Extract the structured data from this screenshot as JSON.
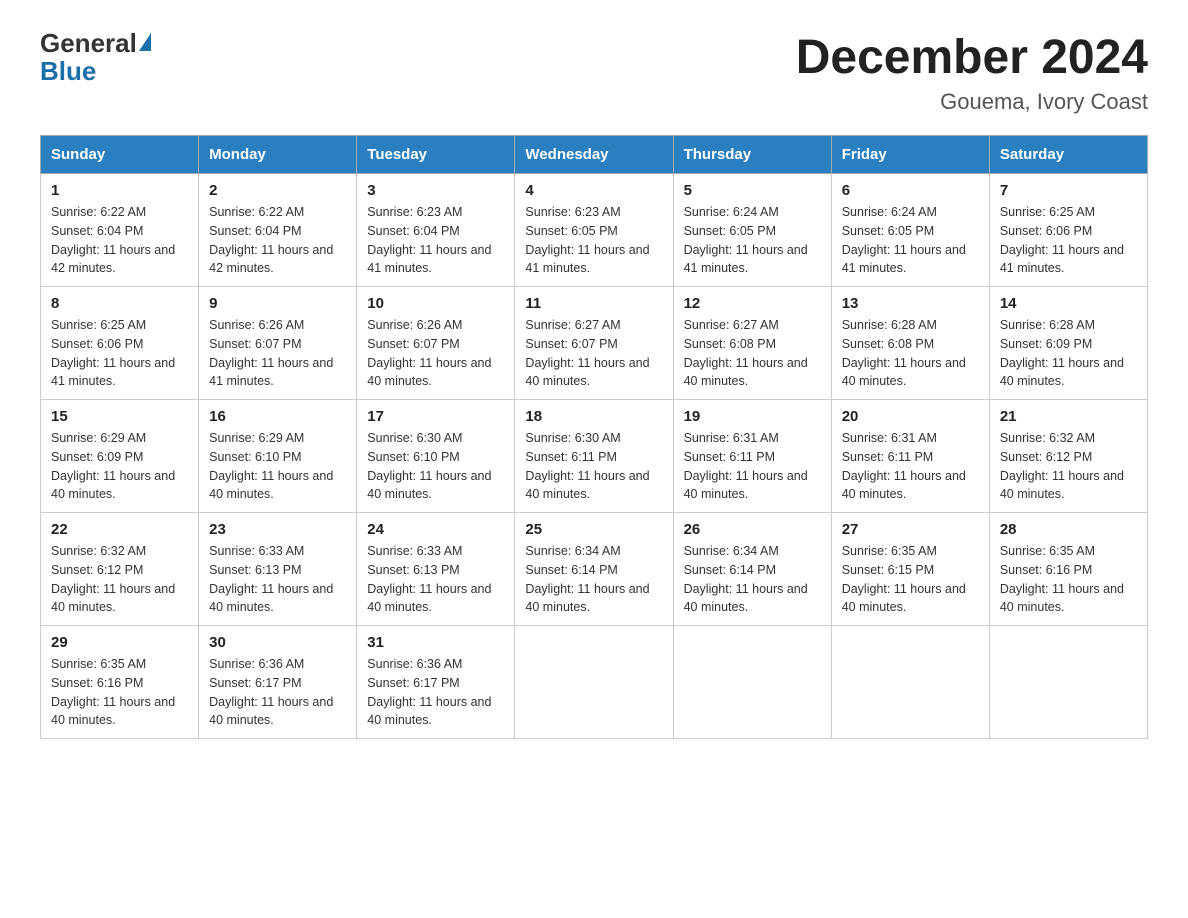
{
  "logo": {
    "general": "General",
    "blue": "Blue"
  },
  "title": "December 2024",
  "subtitle": "Gouema, Ivory Coast",
  "days": [
    "Sunday",
    "Monday",
    "Tuesday",
    "Wednesday",
    "Thursday",
    "Friday",
    "Saturday"
  ],
  "weeks": [
    [
      {
        "day": "1",
        "sunrise": "6:22 AM",
        "sunset": "6:04 PM",
        "daylight": "11 hours and 42 minutes."
      },
      {
        "day": "2",
        "sunrise": "6:22 AM",
        "sunset": "6:04 PM",
        "daylight": "11 hours and 42 minutes."
      },
      {
        "day": "3",
        "sunrise": "6:23 AM",
        "sunset": "6:04 PM",
        "daylight": "11 hours and 41 minutes."
      },
      {
        "day": "4",
        "sunrise": "6:23 AM",
        "sunset": "6:05 PM",
        "daylight": "11 hours and 41 minutes."
      },
      {
        "day": "5",
        "sunrise": "6:24 AM",
        "sunset": "6:05 PM",
        "daylight": "11 hours and 41 minutes."
      },
      {
        "day": "6",
        "sunrise": "6:24 AM",
        "sunset": "6:05 PM",
        "daylight": "11 hours and 41 minutes."
      },
      {
        "day": "7",
        "sunrise": "6:25 AM",
        "sunset": "6:06 PM",
        "daylight": "11 hours and 41 minutes."
      }
    ],
    [
      {
        "day": "8",
        "sunrise": "6:25 AM",
        "sunset": "6:06 PM",
        "daylight": "11 hours and 41 minutes."
      },
      {
        "day": "9",
        "sunrise": "6:26 AM",
        "sunset": "6:07 PM",
        "daylight": "11 hours and 41 minutes."
      },
      {
        "day": "10",
        "sunrise": "6:26 AM",
        "sunset": "6:07 PM",
        "daylight": "11 hours and 40 minutes."
      },
      {
        "day": "11",
        "sunrise": "6:27 AM",
        "sunset": "6:07 PM",
        "daylight": "11 hours and 40 minutes."
      },
      {
        "day": "12",
        "sunrise": "6:27 AM",
        "sunset": "6:08 PM",
        "daylight": "11 hours and 40 minutes."
      },
      {
        "day": "13",
        "sunrise": "6:28 AM",
        "sunset": "6:08 PM",
        "daylight": "11 hours and 40 minutes."
      },
      {
        "day": "14",
        "sunrise": "6:28 AM",
        "sunset": "6:09 PM",
        "daylight": "11 hours and 40 minutes."
      }
    ],
    [
      {
        "day": "15",
        "sunrise": "6:29 AM",
        "sunset": "6:09 PM",
        "daylight": "11 hours and 40 minutes."
      },
      {
        "day": "16",
        "sunrise": "6:29 AM",
        "sunset": "6:10 PM",
        "daylight": "11 hours and 40 minutes."
      },
      {
        "day": "17",
        "sunrise": "6:30 AM",
        "sunset": "6:10 PM",
        "daylight": "11 hours and 40 minutes."
      },
      {
        "day": "18",
        "sunrise": "6:30 AM",
        "sunset": "6:11 PM",
        "daylight": "11 hours and 40 minutes."
      },
      {
        "day": "19",
        "sunrise": "6:31 AM",
        "sunset": "6:11 PM",
        "daylight": "11 hours and 40 minutes."
      },
      {
        "day": "20",
        "sunrise": "6:31 AM",
        "sunset": "6:11 PM",
        "daylight": "11 hours and 40 minutes."
      },
      {
        "day": "21",
        "sunrise": "6:32 AM",
        "sunset": "6:12 PM",
        "daylight": "11 hours and 40 minutes."
      }
    ],
    [
      {
        "day": "22",
        "sunrise": "6:32 AM",
        "sunset": "6:12 PM",
        "daylight": "11 hours and 40 minutes."
      },
      {
        "day": "23",
        "sunrise": "6:33 AM",
        "sunset": "6:13 PM",
        "daylight": "11 hours and 40 minutes."
      },
      {
        "day": "24",
        "sunrise": "6:33 AM",
        "sunset": "6:13 PM",
        "daylight": "11 hours and 40 minutes."
      },
      {
        "day": "25",
        "sunrise": "6:34 AM",
        "sunset": "6:14 PM",
        "daylight": "11 hours and 40 minutes."
      },
      {
        "day": "26",
        "sunrise": "6:34 AM",
        "sunset": "6:14 PM",
        "daylight": "11 hours and 40 minutes."
      },
      {
        "day": "27",
        "sunrise": "6:35 AM",
        "sunset": "6:15 PM",
        "daylight": "11 hours and 40 minutes."
      },
      {
        "day": "28",
        "sunrise": "6:35 AM",
        "sunset": "6:16 PM",
        "daylight": "11 hours and 40 minutes."
      }
    ],
    [
      {
        "day": "29",
        "sunrise": "6:35 AM",
        "sunset": "6:16 PM",
        "daylight": "11 hours and 40 minutes."
      },
      {
        "day": "30",
        "sunrise": "6:36 AM",
        "sunset": "6:17 PM",
        "daylight": "11 hours and 40 minutes."
      },
      {
        "day": "31",
        "sunrise": "6:36 AM",
        "sunset": "6:17 PM",
        "daylight": "11 hours and 40 minutes."
      },
      null,
      null,
      null,
      null
    ]
  ],
  "labels": {
    "sunrise": "Sunrise:",
    "sunset": "Sunset:",
    "daylight": "Daylight:"
  }
}
